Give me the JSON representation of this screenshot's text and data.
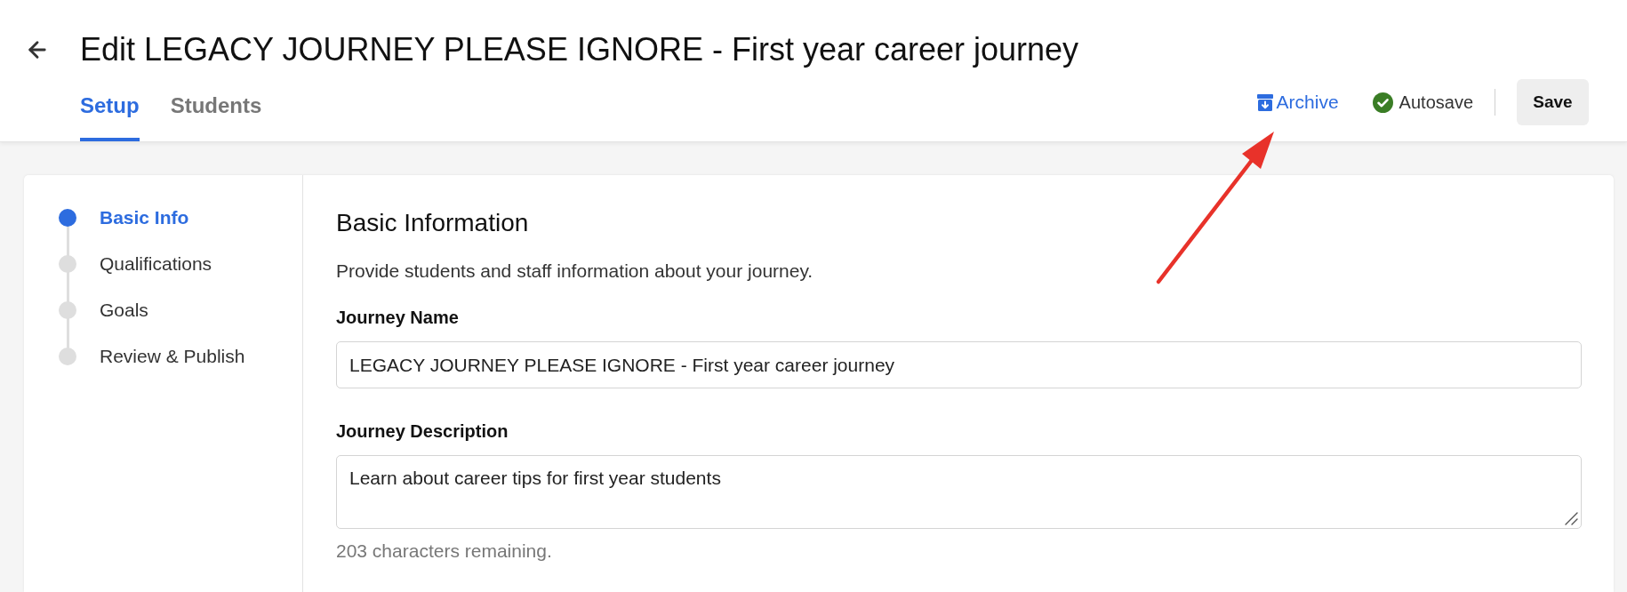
{
  "header": {
    "title": "Edit LEGACY JOURNEY PLEASE IGNORE - First year career journey",
    "tabs": [
      {
        "label": "Setup",
        "selected": true
      },
      {
        "label": "Students",
        "selected": false
      }
    ],
    "actions": [
      {
        "kind": "archive",
        "label": "Archive"
      },
      {
        "kind": "autosave",
        "label": "Autosave",
        "on": true
      },
      {
        "kind": "save",
        "label": "Save"
      }
    ]
  },
  "steps": [
    {
      "label": "Basic Info",
      "selected": true
    },
    {
      "label": "Qualifications",
      "selected": false
    },
    {
      "label": "Goals",
      "selected": false
    },
    {
      "label": "Review & Publish",
      "selected": false
    }
  ],
  "section": {
    "title": "Basic Information",
    "description": "Provide students and staff information about your journey.",
    "fields": [
      {
        "kind": "input",
        "label": "Journey Name",
        "value": "LEGACY JOURNEY PLEASE IGNORE - First year career journey"
      },
      {
        "kind": "textarea",
        "label": "Journey Description",
        "value": "Learn about career tips for first year students",
        "helper": "203 characters remaining."
      }
    ]
  }
}
